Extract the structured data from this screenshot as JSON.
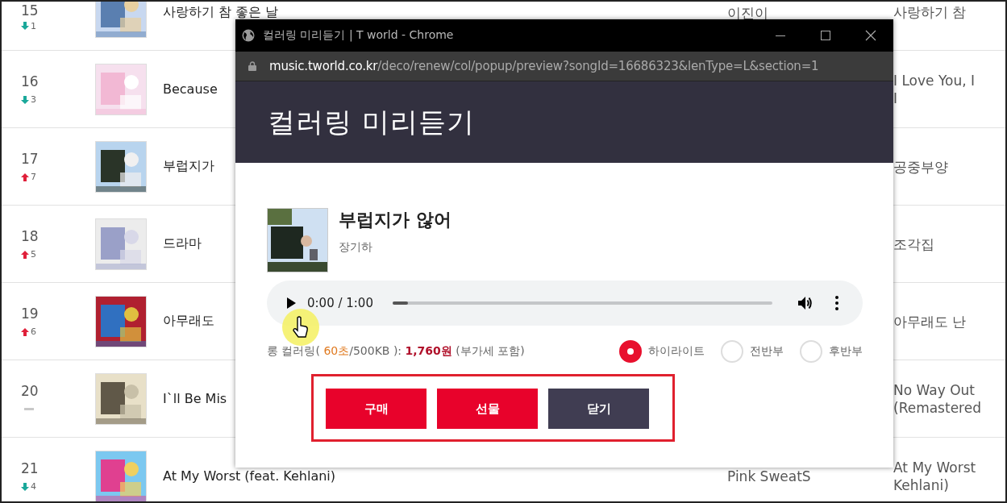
{
  "chart_rows": [
    {
      "rank": "15",
      "change": {
        "kind": "down",
        "amount": "1"
      },
      "title": "사랑하기 참 좋은 날",
      "artist": "이진이",
      "album": [
        "사랑하기 참"
      ]
    },
    {
      "rank": "16",
      "change": {
        "kind": "down",
        "amount": "3"
      },
      "title": "Because",
      "album": [
        "I Love You, I",
        "I"
      ]
    },
    {
      "rank": "17",
      "change": {
        "kind": "up",
        "amount": "7"
      },
      "title": "부럽지가",
      "album": [
        "공중부양"
      ]
    },
    {
      "rank": "18",
      "change": {
        "kind": "up",
        "amount": "5"
      },
      "title": "드라마",
      "album": [
        "조각집"
      ]
    },
    {
      "rank": "19",
      "change": {
        "kind": "up",
        "amount": "6"
      },
      "title": "아무래도",
      "album": [
        "아무래도 난"
      ]
    },
    {
      "rank": "20",
      "change": {
        "kind": "same"
      },
      "title": "I`ll Be Mis",
      "album": [
        "No Way Out",
        "(Remastered"
      ]
    },
    {
      "rank": "21",
      "change": {
        "kind": "down",
        "amount": "4"
      },
      "title": "At My Worst (feat. Kehlani)",
      "artist": "Pink SweatS",
      "album": [
        "At My Worst",
        "Kehlani)"
      ]
    }
  ],
  "popup": {
    "window_title": "컬러링 미리듣기 | T world - Chrome",
    "url_host": "music.tworld.co.kr",
    "url_path": "/deco/renew/col/popup/preview?songId=16686323&lenType=L&section=1",
    "heading": "컬러링 미리듣기",
    "song": {
      "title": "부럽지가 않어",
      "artist": "장기하"
    },
    "player": {
      "time": "0:00 / 1:00",
      "level": 0.04
    },
    "price_info": [
      {
        "kind": "plain",
        "text": "롱 컬러링( "
      },
      {
        "kind": "duration",
        "text": "60초"
      },
      {
        "kind": "plain",
        "text": "/500KB ): "
      },
      {
        "kind": "price",
        "text": "1,760원"
      },
      {
        "kind": "plain",
        "text": " (부가세 포함)"
      }
    ],
    "sections": [
      {
        "label": "하이라이트",
        "selected": true
      },
      {
        "label": "전반부",
        "selected": false
      },
      {
        "label": "후반부",
        "selected": false
      }
    ],
    "buttons": [
      {
        "label": "구매",
        "kind": "primary"
      },
      {
        "label": "선물",
        "kind": "primary"
      },
      {
        "label": "닫기",
        "kind": "secondary"
      }
    ]
  }
}
